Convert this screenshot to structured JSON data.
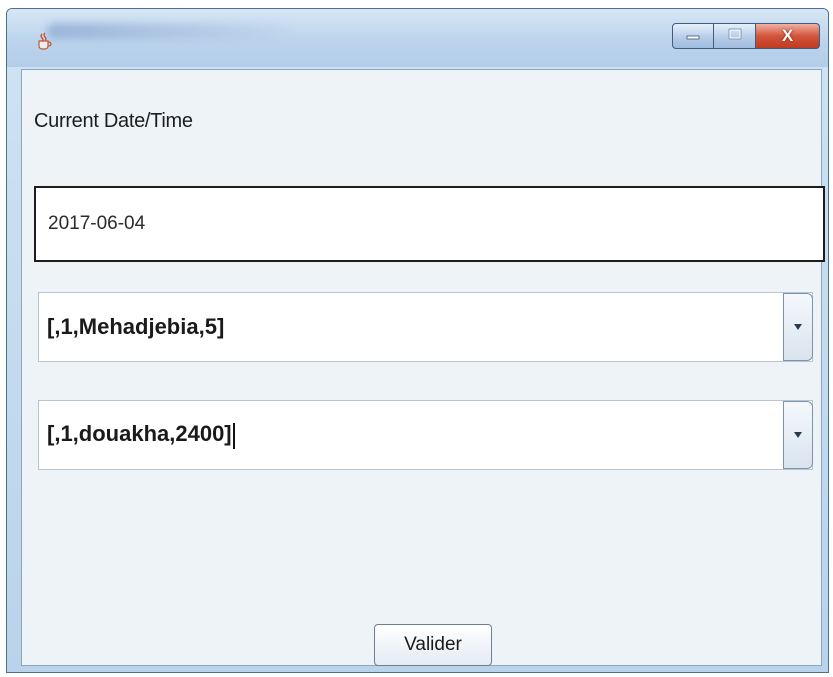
{
  "window": {
    "controls": {
      "minimize_icon": "minimize-icon",
      "maximize_icon": "maximize-icon",
      "close_label": "X"
    },
    "app_icon": "java-cup-icon"
  },
  "form": {
    "date_label": "Current Date/Time",
    "date_value": "2017-06-04",
    "combo1": {
      "value": "[,1,Mehadjebia,5]"
    },
    "combo2": {
      "value": "[,1,douakha,2400]"
    },
    "submit_label": "Valider"
  },
  "colors": {
    "title_bar": "#bcd4ec",
    "close_button": "#d2543b",
    "content_bg": "#eef3f8"
  }
}
